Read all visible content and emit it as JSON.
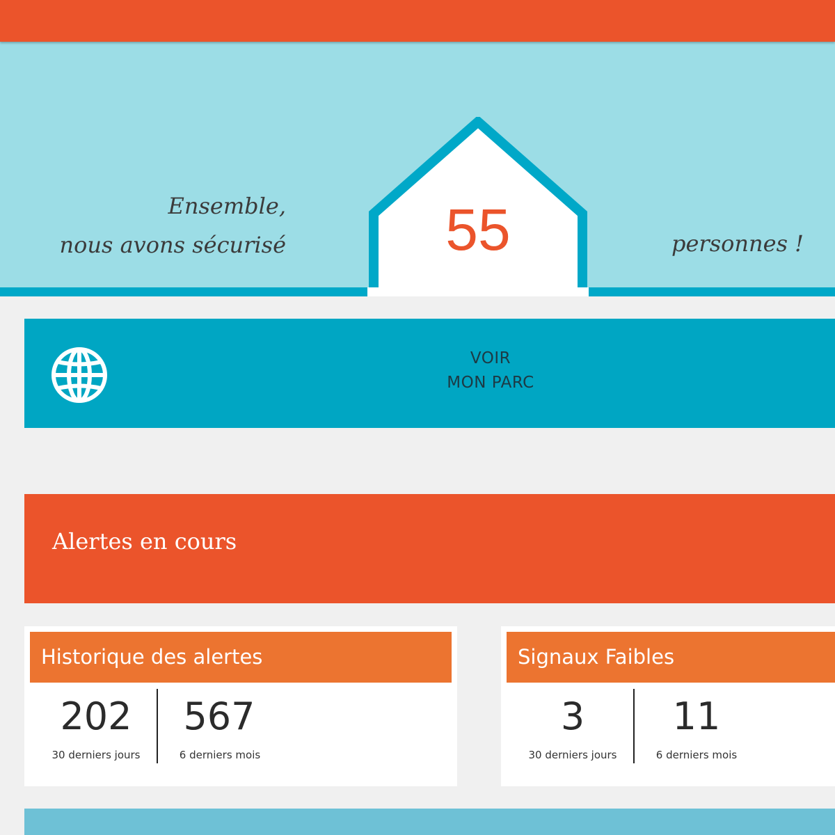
{
  "header": {
    "bar_color": "#eb542b"
  },
  "hero": {
    "line1": "Ensemble,",
    "line2": "nous avons sécurisé",
    "count": "55",
    "suffix": "personnes !",
    "background_color": "#9cdde6",
    "house_outline_color": "#00a8c8"
  },
  "parc_button": {
    "icon": "globe-icon",
    "line1": "VOIR",
    "line2": "MON PARC",
    "color": "#00a6c3"
  },
  "alerts_banner": {
    "title": "Alertes en cours",
    "color": "#eb542b"
  },
  "cards": {
    "historique": {
      "title": "Historique des alertes",
      "stats": [
        {
          "value": "202",
          "caption": "30 derniers jours"
        },
        {
          "value": "567",
          "caption": "6 derniers mois"
        }
      ]
    },
    "signaux": {
      "title": "Signaux Faibles",
      "stats": [
        {
          "value": "3",
          "caption": "30 derniers jours"
        },
        {
          "value": "11",
          "caption": "6 derniers mois"
        }
      ]
    },
    "header_color": "#ec7430"
  }
}
